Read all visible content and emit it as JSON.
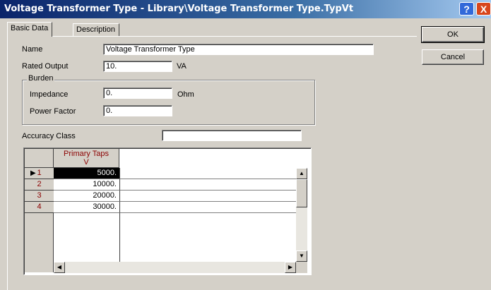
{
  "window": {
    "title": "Voltage Transformer Type - Library\\Voltage Transformer Type.TypVt",
    "help_label": "?",
    "close_label": "X"
  },
  "tabs": [
    {
      "label": "Basic Data",
      "active": true
    },
    {
      "label": "Description",
      "active": false
    }
  ],
  "buttons": {
    "ok": "OK",
    "cancel": "Cancel"
  },
  "form": {
    "name_label": "Name",
    "name_value": "Voltage Transformer Type",
    "rated_output_label": "Rated Output",
    "rated_output_value": "10.",
    "rated_output_unit": "VA",
    "burden_title": "Burden",
    "impedance_label": "Impedance",
    "impedance_value": "0.",
    "impedance_unit": "Ohm",
    "power_factor_label": "Power Factor",
    "power_factor_value": "0.",
    "accuracy_class_label": "Accuracy Class",
    "accuracy_class_value": ""
  },
  "grid": {
    "column_header_line1": "Primary Taps",
    "column_header_line2": "V",
    "current_row_marker": "▶",
    "rows": [
      {
        "num": "1",
        "value": "5000."
      },
      {
        "num": "2",
        "value": "10000."
      },
      {
        "num": "3",
        "value": "20000."
      },
      {
        "num": "4",
        "value": "30000."
      }
    ]
  }
}
